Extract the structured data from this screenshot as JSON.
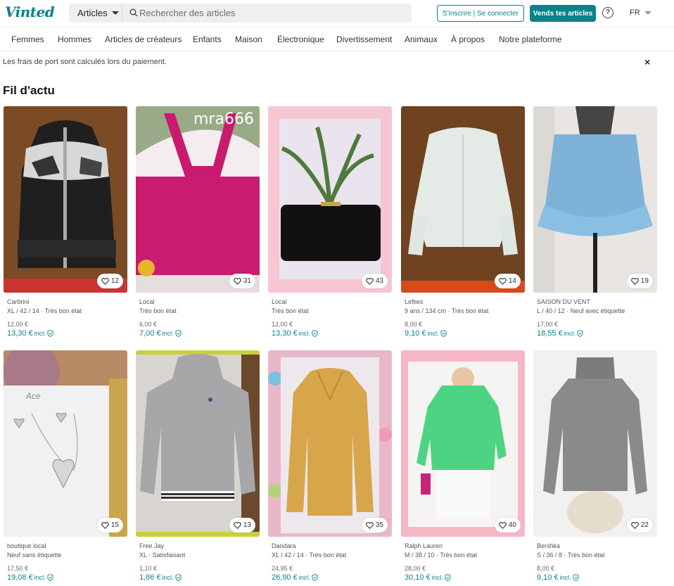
{
  "header": {
    "logo": "Vinted",
    "search_category": "Articles",
    "search_placeholder": "Rechercher des articles",
    "login_button": "S'inscrire | Se connecter",
    "sell_button": "Vends tes articles",
    "help_icon": "?",
    "language": "FR"
  },
  "nav": {
    "items": [
      "Femmes",
      "Hommes",
      "Articles de créateurs",
      "Enfants",
      "Maison",
      "Électronique",
      "Divertissement",
      "Animaux",
      "À propos",
      "Notre plateforme"
    ]
  },
  "banner": {
    "text": "Les frais de port sont calculés lors du paiement.",
    "close": "×"
  },
  "feed": {
    "title": "Fil d'actu",
    "incl_label": "incl.",
    "items": [
      {
        "brand": "Carbrini",
        "details": "XL / 42 / 14 · Très bon état",
        "price": "12,00 €",
        "total": "13,30 €",
        "likes": "12"
      },
      {
        "brand": "Local",
        "details": "Très bon état",
        "price": "6,00 €",
        "total": "7,00 €",
        "likes": "31"
      },
      {
        "brand": "Local",
        "details": "Très bon état",
        "price": "12,00 €",
        "total": "13,30 €",
        "likes": "43"
      },
      {
        "brand": "Lefties",
        "details": "9 ans / 134 cm · Très bon état",
        "price": "8,00 €",
        "total": "9,10 €",
        "likes": "14"
      },
      {
        "brand": "SAISON DU VENT",
        "details": "L / 40 / 12 · Neuf avec étiquette",
        "price": "17,00 €",
        "total": "18,55 €",
        "likes": "19"
      },
      {
        "brand": "boutique local",
        "details": "Neuf sans étiquette",
        "price": "17,50 €",
        "total": "19,08 €",
        "likes": "15"
      },
      {
        "brand": "Free Jay",
        "details": "XL · Satisfaisant",
        "price": "1,10 €",
        "total": "1,86 €",
        "likes": "13"
      },
      {
        "brand": "Dandara",
        "details": "XL / 42 / 14 · Très bon état",
        "price": "24,95 €",
        "total": "26,90 €",
        "likes": "35"
      },
      {
        "brand": "Ralph Lauren",
        "details": "M / 38 / 10 · Très bon état",
        "price": "28,00 €",
        "total": "30,10 €",
        "likes": "40"
      },
      {
        "brand": "Bershka",
        "details": "S / 36 / 8 · Très bon état",
        "price": "8,00 €",
        "total": "9,10 €",
        "likes": "22"
      }
    ]
  },
  "photo_overlay_texts": {
    "watermark": "mra666",
    "card_text": "Ace"
  },
  "colors": {
    "brand": "#09828a"
  }
}
